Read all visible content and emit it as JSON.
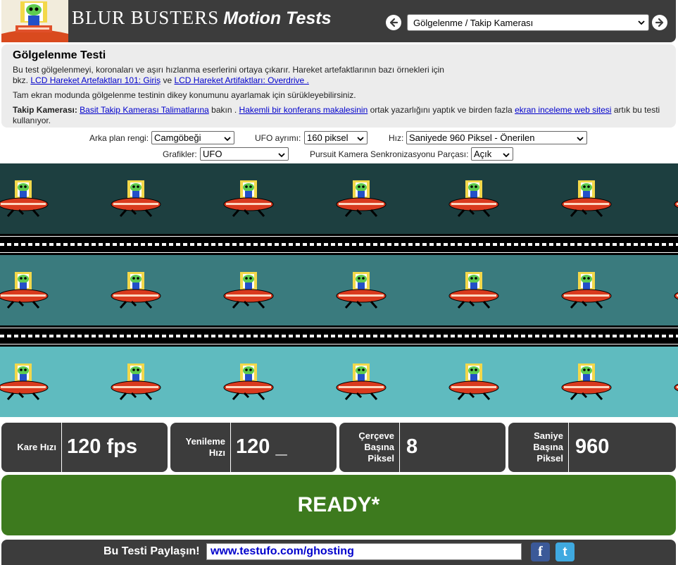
{
  "header": {
    "brand_main": "BLUR BUSTERS",
    "brand_suffix": "Motion Tests",
    "test_selected": "Gölgelenme / Takip Kamerası"
  },
  "info": {
    "title": "Gölgelenme Testi",
    "para1_text": "Bu test gölgelenmeyi, koronaları ve aşırı hızlanma eserlerini ortaya çıkarır. Hareket artefaktlarının bazı örnekleri için",
    "para1_prefix": "bkz.",
    "link1": "LCD Hareket Artefaktları 101: Giriş",
    "para1_and": "ve",
    "link2": "LCD Hareket Artifaktları: Overdrive .",
    "para2": "Tam ekran modunda gölgelenme testinin dikey konumunu ayarlamak için sürükleyebilirsiniz.",
    "para3_bold": "Takip Kamerası:",
    "link3": "Basit Takip Kamerası Talimatlarına",
    "para3_mid1": "bakın .",
    "link4": "Hakemli bir konferans makalesinin",
    "para3_mid2": "ortak yazarlığını yaptık ve birden fazla",
    "link5": "ekran inceleme web sitesi",
    "para3_end": "artık bu testi kullanıyor."
  },
  "controls": {
    "bg_label": "Arka plan rengi:",
    "bg_value": "Camgöbeği",
    "sep_label": "UFO ayrımı:",
    "sep_value": "160 piksel",
    "speed_label": "Hız:",
    "speed_value": "Saniyede 960 Piksel - Önerilen",
    "graphics_label": "Grafikler:",
    "graphics_value": "UFO",
    "sync_label": "Pursuit Kamera Senkronizasyonu Parçası:",
    "sync_value": "Açık"
  },
  "bands": [
    {
      "color": "#1d3f40"
    },
    {
      "color": "#3a7b7e"
    },
    {
      "color": "#5fbbbf"
    }
  ],
  "stats": {
    "fps_label": "Kare Hızı",
    "fps_value": "120 fps",
    "refresh_label": "Yenileme Hızı",
    "refresh_value": "120 _",
    "ppf_label": "Çerçeve Başına Piksel",
    "ppf_value": "8",
    "pps_label": "Saniye Başına Piksel",
    "pps_value": "960"
  },
  "status": {
    "ready": "READY*"
  },
  "share": {
    "label": "Bu Testi Paylaşın!",
    "url": "www.testufo.com/ghosting",
    "facebook": "f",
    "twitter": "t"
  },
  "icons": [
    "back-arrow-icon",
    "forward-arrow-icon",
    "facebook-icon",
    "twitter-icon",
    "ufo-icon",
    "alien-logo-icon"
  ]
}
